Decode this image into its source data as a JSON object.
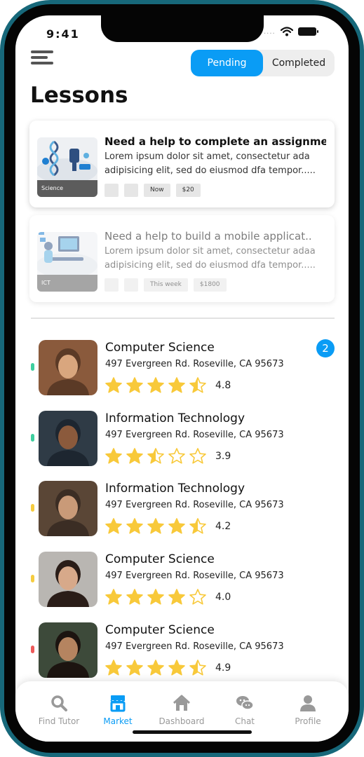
{
  "status_bar": {
    "time": "9:41",
    "signal": "....",
    "icons": [
      "wifi-icon",
      "battery-icon"
    ]
  },
  "header": {
    "menu_icon": "hamburger-menu-icon",
    "segments": {
      "pending": "Pending",
      "completed": "Completed",
      "selected": "Pending"
    },
    "title": "Lessons"
  },
  "lessons": [
    {
      "title": "Need a help to complete an assignme..",
      "desc1": "Lorem ipsum dolor sit amet, consectetur ada",
      "desc2": "adipisicing elit, sed do eiusmod dfa tempor.....",
      "category": "Science",
      "time": "Now",
      "price": "$20"
    },
    {
      "title": "Need a help to build a mobile applicat..",
      "desc1": "Lorem ipsum dolor sit amet, consectetur adaa",
      "desc2": "adipisicing elit, sed do eiusmod dfa tempor.....",
      "category": "ICT",
      "time": "This week",
      "price": "$1800"
    }
  ],
  "tutors": [
    {
      "subject": "Computer Science",
      "address": "497 Evergreen Rd. Roseville,  CA 95673",
      "rating": "4.8",
      "stars": 4.5,
      "status_color": "#3ecf9f",
      "badge": "2"
    },
    {
      "subject": "Information Technology",
      "address": "497 Evergreen Rd. Roseville,  CA 95673",
      "rating": "3.9",
      "stars": 2.5,
      "status_color": "#3ecf9f"
    },
    {
      "subject": "Information Technology",
      "address": "497 Evergreen Rd. Roseville,  CA 95673",
      "rating": "4.2",
      "stars": 4.5,
      "status_color": "#f5cc40"
    },
    {
      "subject": "Computer Science",
      "address": "497 Evergreen Rd. Roseville,  CA 95673",
      "rating": "4.0",
      "stars": 4,
      "status_color": "#f5cc40"
    },
    {
      "subject": "Computer Science",
      "address": "497 Evergreen Rd. Roseville,  CA 95673",
      "rating": "4.9",
      "stars": 4.5,
      "status_color": "#ee5a5a"
    }
  ],
  "bottom_nav": [
    {
      "label": "Find Tutor",
      "icon": "search-icon"
    },
    {
      "label": "Market",
      "icon": "store-icon",
      "active": true
    },
    {
      "label": "Dashboard",
      "icon": "home-icon"
    },
    {
      "label": "Chat",
      "icon": "chat-icon"
    },
    {
      "label": "Profile",
      "icon": "profile-icon"
    }
  ],
  "colors": {
    "accent": "#0a9cf5",
    "star": "#f8c93a",
    "frame": "#17687a"
  }
}
